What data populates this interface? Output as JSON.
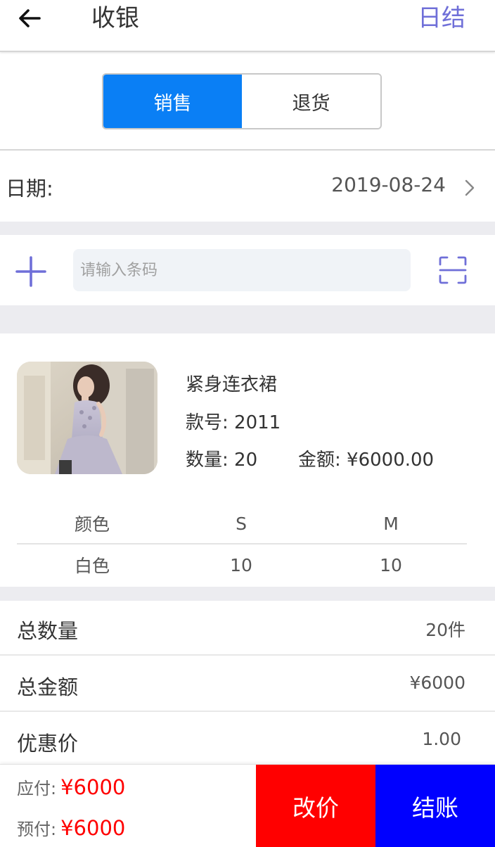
{
  "header": {
    "title": "收银",
    "action": "日结"
  },
  "segment": {
    "tabs": [
      {
        "label": "销售",
        "active": true
      },
      {
        "label": "退货",
        "active": false
      }
    ]
  },
  "date": {
    "label": "日期:",
    "value": "2019-08-24"
  },
  "search": {
    "placeholder": "请输入条码"
  },
  "product": {
    "name": "紧身连衣裙",
    "style_line": "款号: 2011",
    "qty_line": "数量: 20",
    "amount_line": "金额: ¥6000.00",
    "size_table": {
      "headers": [
        "颜色",
        "S",
        "M"
      ],
      "rows": [
        [
          "白色",
          "10",
          "10"
        ]
      ]
    }
  },
  "summary": {
    "total_qty_label": "总数量",
    "total_qty_value": "20件",
    "total_amount_label": "总金额",
    "total_amount_value": "¥6000",
    "discount_label": "优惠价",
    "discount_value": "1.00"
  },
  "bottom": {
    "payable_label": "应付:",
    "payable_value": "¥6000",
    "prepaid_label": "预付:",
    "prepaid_value": "¥6000",
    "change_price_label": "改价",
    "checkout_label": "结账"
  },
  "colors": {
    "accent": "#0a7ff5",
    "icon_purple": "#6f6fd8",
    "price_red": "#ff0000",
    "change_button": "#ff0000",
    "checkout_button": "#0000ff"
  }
}
